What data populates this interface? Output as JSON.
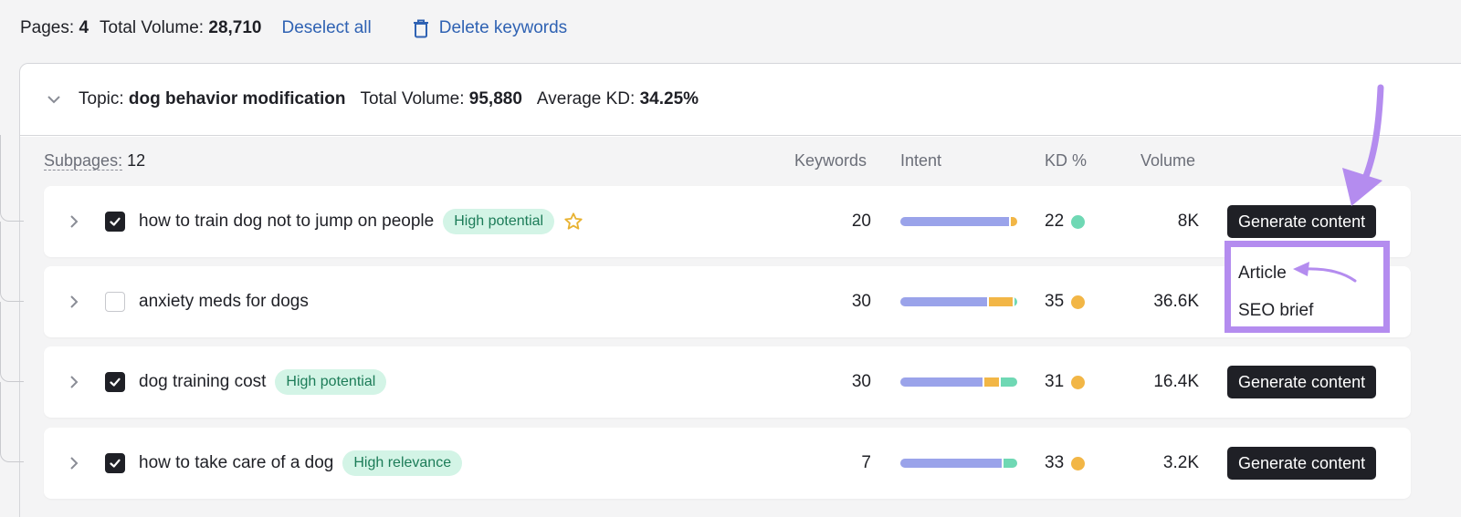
{
  "topbar": {
    "pages_label": "Pages:",
    "pages_value": "4",
    "volume_label": "Total Volume:",
    "volume_value": "28,710",
    "deselect_label": "Deselect all",
    "delete_label": "Delete keywords"
  },
  "topic": {
    "label": "Topic:",
    "name": "dog behavior modification",
    "volume_label": "Total Volume:",
    "volume_value": "95,880",
    "kd_label": "Average KD:",
    "kd_value": "34.25%"
  },
  "columns": {
    "subpages_label": "Subpages:",
    "subpages_count": "12",
    "keywords": "Keywords",
    "intent": "Intent",
    "kd": "KD %",
    "volume": "Volume"
  },
  "rows": [
    {
      "title": "how to train dog not to jump on people",
      "checked": true,
      "badge": "High potential",
      "starred": true,
      "keywords": "20",
      "intent": [
        {
          "color": "#9aa3ea",
          "share": 0.93
        },
        {
          "color": "#f2b646",
          "share": 0.07
        }
      ],
      "kd": "22",
      "kd_color": "#6fd8b4",
      "volume": "8K",
      "button": "Generate content"
    },
    {
      "title": "anxiety meds for dogs",
      "checked": false,
      "badge": "",
      "starred": false,
      "keywords": "30",
      "intent": [
        {
          "color": "#9aa3ea",
          "share": 0.74
        },
        {
          "color": "#f2b646",
          "share": 0.22
        },
        {
          "color": "#6fd8b4",
          "share": 0.04
        }
      ],
      "kd": "35",
      "kd_color": "#f2b646",
      "volume": "36.6K",
      "button": ""
    },
    {
      "title": "dog training cost",
      "checked": true,
      "badge": "High potential",
      "starred": false,
      "keywords": "30",
      "intent": [
        {
          "color": "#9aa3ea",
          "share": 0.7
        },
        {
          "color": "#f2b646",
          "share": 0.14
        },
        {
          "color": "#6fd8b4",
          "share": 0.16
        }
      ],
      "kd": "31",
      "kd_color": "#f2b646",
      "volume": "16.4K",
      "button": "Generate content"
    },
    {
      "title": "how to take care of a dog",
      "checked": true,
      "badge": "High relevance",
      "starred": false,
      "keywords": "7",
      "intent": [
        {
          "color": "#9aa3ea",
          "share": 0.87
        },
        {
          "color": "#6fd8b4",
          "share": 0.13
        }
      ],
      "kd": "33",
      "kd_color": "#f2b646",
      "volume": "3.2K",
      "button": "Generate content"
    }
  ],
  "dropdown": {
    "items": [
      "Article",
      "SEO brief"
    ]
  },
  "annotation_color": "#b48cef",
  "icons": [
    "trash-icon",
    "chevron-down-icon",
    "chevron-right-icon",
    "checkmark-icon",
    "star-icon",
    "arrow-icon"
  ]
}
